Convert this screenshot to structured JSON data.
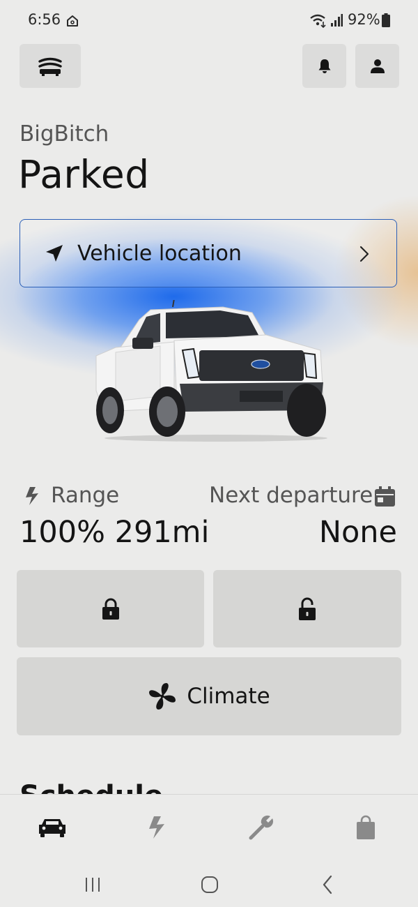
{
  "status_bar": {
    "time": "6:56",
    "battery": "92%"
  },
  "header": {
    "garage_icon": "garage-icon",
    "notifications_icon": "bell-icon",
    "profile_icon": "person-icon"
  },
  "vehicle": {
    "name": "BigBitch",
    "status": "Parked"
  },
  "location_card": {
    "label": "Vehicle location",
    "icon": "navigation-arrow-icon"
  },
  "stats": {
    "range_label": "Range",
    "range_value": "100% 291mi",
    "next_departure_label": "Next departure",
    "next_departure_value": "None"
  },
  "actions": {
    "lock_icon": "lock-icon",
    "unlock_icon": "unlock-icon",
    "climate_label": "Climate",
    "climate_icon": "fan-icon"
  },
  "next_section": {
    "heading": "Schedule"
  },
  "bottom_nav": {
    "items": [
      {
        "icon": "car-icon",
        "active": true
      },
      {
        "icon": "lightning-icon",
        "active": false
      },
      {
        "icon": "wrench-icon",
        "active": false
      },
      {
        "icon": "shopping-bag-icon",
        "active": false
      }
    ]
  },
  "colors": {
    "background": "#ebebea",
    "accent_blue": "#2b5fb7",
    "button_bg": "#d6d6d4",
    "text_primary": "#141414",
    "text_secondary": "#555555"
  }
}
